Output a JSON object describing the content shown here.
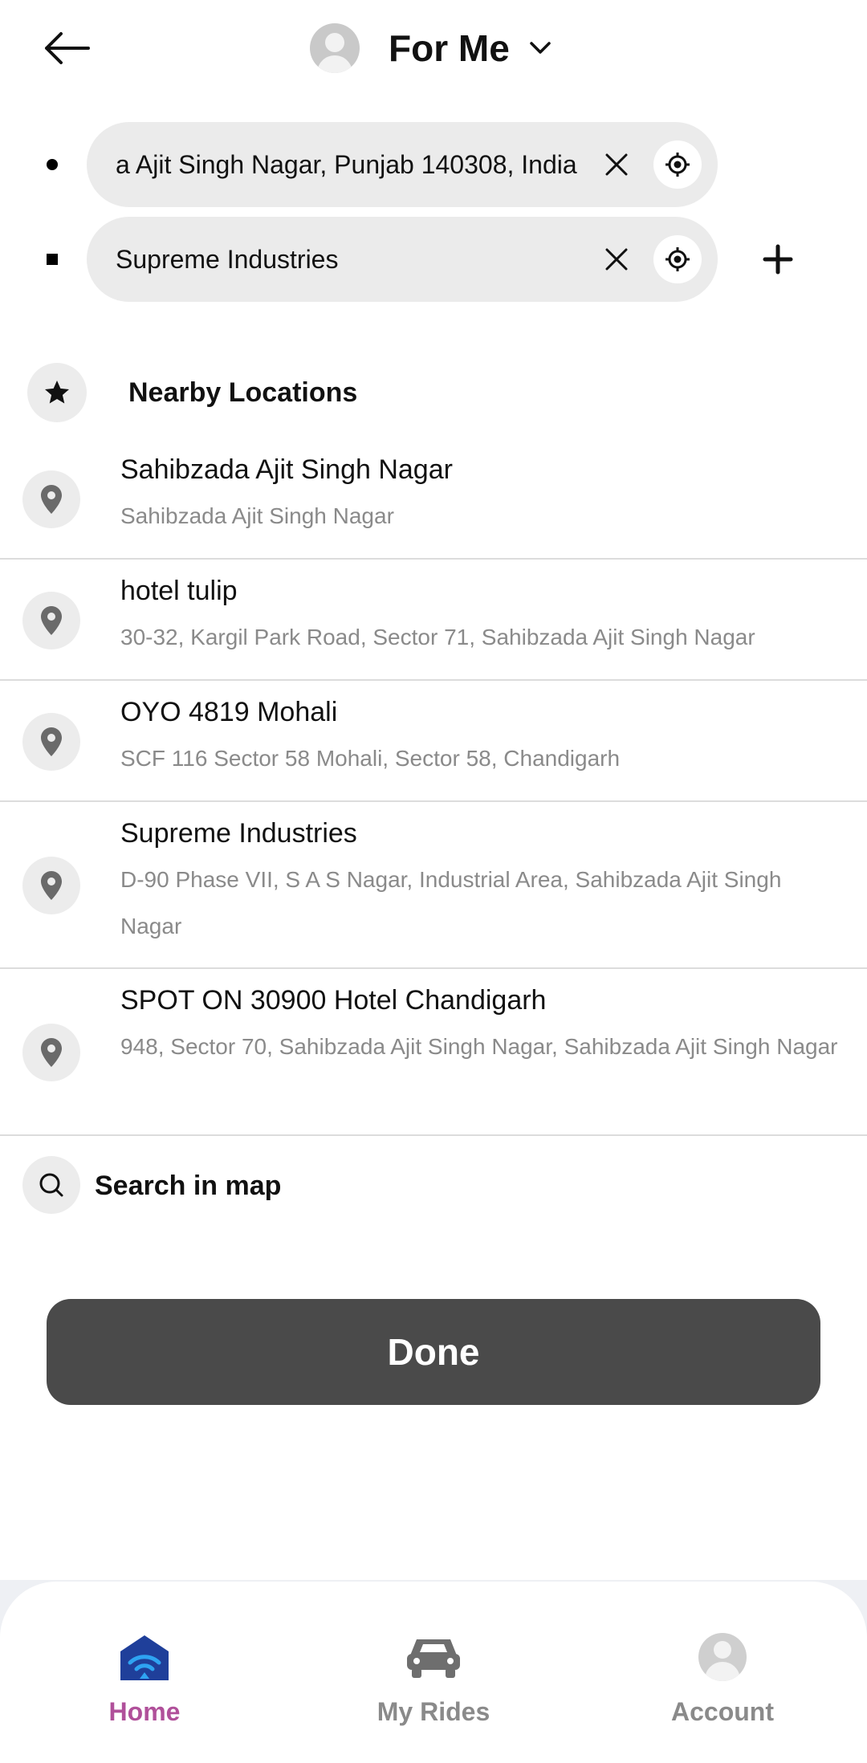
{
  "header": {
    "rider_label": "For Me"
  },
  "pickup": {
    "value": "a Ajit Singh Nagar, Punjab 140308, India"
  },
  "drop": {
    "value": "Supreme Industries"
  },
  "nearby": {
    "title": "Nearby Locations",
    "items": [
      {
        "name": "Sahibzada Ajit Singh Nagar",
        "address": "Sahibzada Ajit Singh Nagar"
      },
      {
        "name": "hotel tulip",
        "address": "30-32, Kargil Park Road, Sector 71, Sahibzada Ajit Singh Nagar"
      },
      {
        "name": "OYO 4819 Mohali",
        "address": "SCF 116 Sector 58 Mohali, Sector 58, Chandigarh"
      },
      {
        "name": "Supreme Industries",
        "address": "D-90 Phase VII, S A S Nagar, Industrial Area, Sahibzada Ajit Singh Nagar"
      },
      {
        "name": "SPOT ON 30900 Hotel Chandigarh",
        "address": "948, Sector 70, Sahibzada Ajit Singh Nagar, Sahibzada Ajit Singh Nagar"
      }
    ]
  },
  "search_map": {
    "label": "Search in map"
  },
  "done": {
    "label": "Done"
  },
  "bottom_nav": {
    "home": "Home",
    "rides": "My Rides",
    "account": "Account"
  },
  "colors": {
    "accent_pink": "#b0509a",
    "home_blue": "#1f3f9a",
    "done_bg": "#4a4a4a",
    "field_bg": "#ebebeb"
  },
  "icons": {
    "back": "back-arrow-icon",
    "rider_avatar": "user-avatar-icon",
    "dropdown": "chevron-down-icon",
    "clear": "close-icon",
    "gps": "gps-target-icon",
    "add": "plus-icon",
    "star": "star-icon",
    "pin": "map-pin-icon",
    "search": "search-icon",
    "home": "home-icon",
    "car": "car-icon",
    "account": "user-avatar-icon"
  }
}
